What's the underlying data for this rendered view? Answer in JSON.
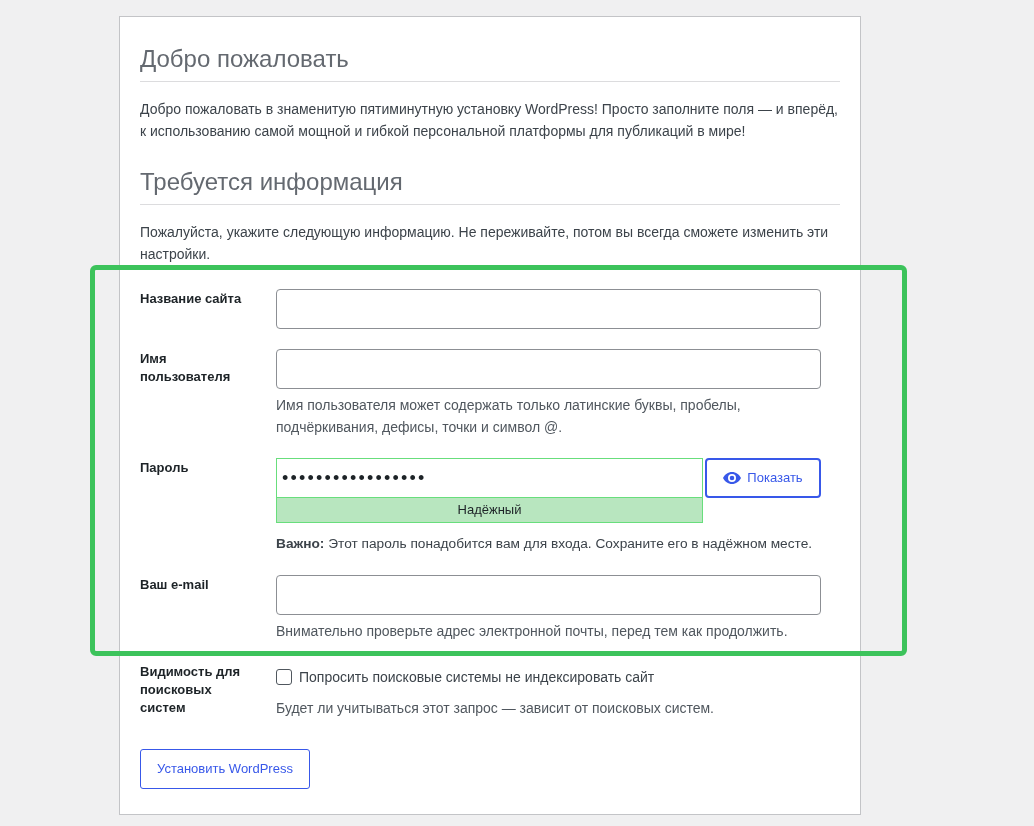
{
  "sections": [
    {
      "heading": "Добро пожаловать",
      "text": "Добро пожаловать в знаменитую пятиминутную установку WordPress! Просто заполните поля — и вперёд, к использованию самой мощной и гибкой персональной платформы для публикаций в мире!"
    },
    {
      "heading": "Требуется информация",
      "text": "Пожалуйста, укажите следующую информацию. Не переживайте, потом вы всегда сможете изменить эти настройки."
    }
  ],
  "form": {
    "fields": [
      {
        "kind": "text",
        "label": "Название сайта"
      },
      {
        "kind": "text",
        "label": "Имя пользователя",
        "hint": "Имя пользователя может содержать только латинские буквы, пробелы, подчёркивания, дефисы, точки и символ @."
      },
      {
        "kind": "password",
        "label": "Пароль",
        "value": "•••••••••••••••••",
        "strength": "Надёжный",
        "show_button": "Показать",
        "note": "**Важно:** Этот пароль понадобится вам для входа. Сохраните его в надёжном месте."
      },
      {
        "kind": "text",
        "label": "Ваш e-mail",
        "hint": "Внимательно проверьте адрес электронной почты, перед тем как продолжить."
      },
      {
        "kind": "checkbox",
        "label": "Видимость для поисковых систем",
        "option": "Попросить поисковые системы не индексировать сайт",
        "checked": false,
        "hint": "Будет ли учитываться этот запрос — зависит от поисковых систем."
      }
    ]
  },
  "submit_button": "Установить WordPress"
}
